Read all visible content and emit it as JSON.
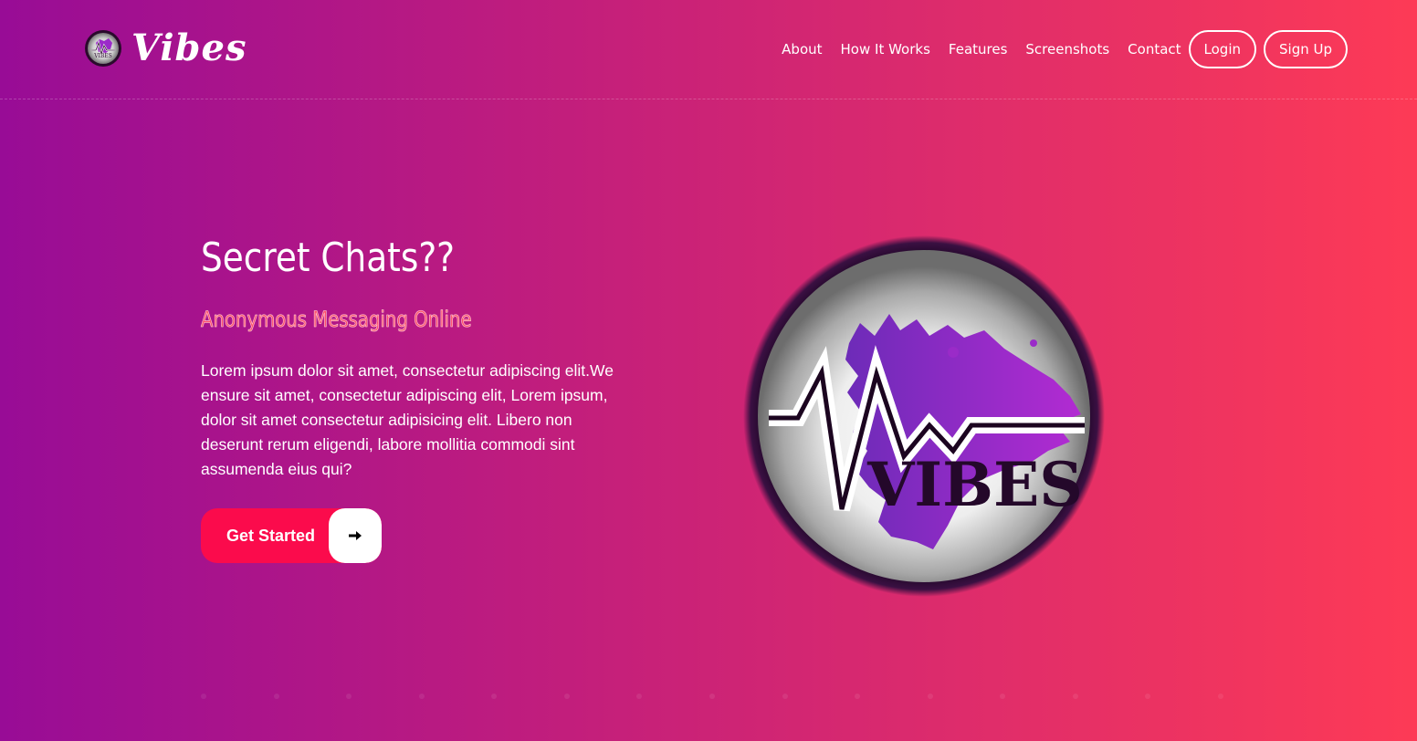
{
  "brand": {
    "name": "Vibes",
    "logo_icon": "vibes-logo-icon"
  },
  "nav": {
    "links": [
      "About",
      "How It Works",
      "Features",
      "Screenshots",
      "Contact"
    ],
    "login_label": "Login",
    "signup_label": "Sign Up"
  },
  "hero": {
    "title": "Secret Chats??",
    "subtitle": "Anonymous Messaging Online",
    "body": "Lorem ipsum dolor sit amet, consectetur adipiscing elit.We ensure sit amet, consectetur adipiscing elit, Lorem ipsum, dolor sit amet consectetur adipisicing elit. Libero non deserunt rerum eligendi, labore mollitia commodi sint assumenda eius qui?",
    "cta_label": "Get Started",
    "cta_icon": "arrow-right-icon",
    "logo_text": "VIBES"
  },
  "colors": {
    "gradient_start": "#980c96",
    "gradient_end": "#fd3a56",
    "cta_background": "#fb0b4c",
    "subtitle": "#ff4f6c",
    "logo_splash": "#9b2bc9"
  }
}
